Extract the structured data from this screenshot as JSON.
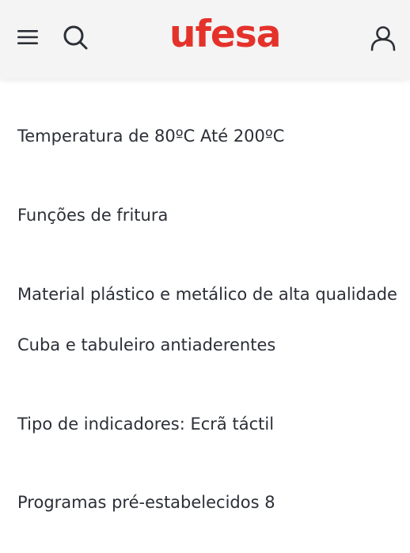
{
  "header": {
    "logo_text": "ufesa",
    "menu_icon": "hamburger-menu-icon",
    "search_icon": "search-icon",
    "account_icon": "user-account-icon"
  },
  "specs": [
    {
      "label": "Temperatura",
      "value": " de 80ºC Até 200ºC"
    },
    {
      "label": "Funções",
      "value": " de fritura"
    },
    {
      "label": "Material",
      "value": " plástico e metálico de alta qualidade"
    },
    {
      "label": "Cuba e tabuleiro",
      "value": " antiaderentes"
    },
    {
      "label": "Tipo de indicadores:",
      "value": " Ecrã táctil"
    },
    {
      "label": "Programas pré-estabelecidos",
      "value": " 8"
    }
  ],
  "colors": {
    "brand": "#e4322b",
    "text": "#2b2f36",
    "header_bg": "#f4f4f4"
  }
}
